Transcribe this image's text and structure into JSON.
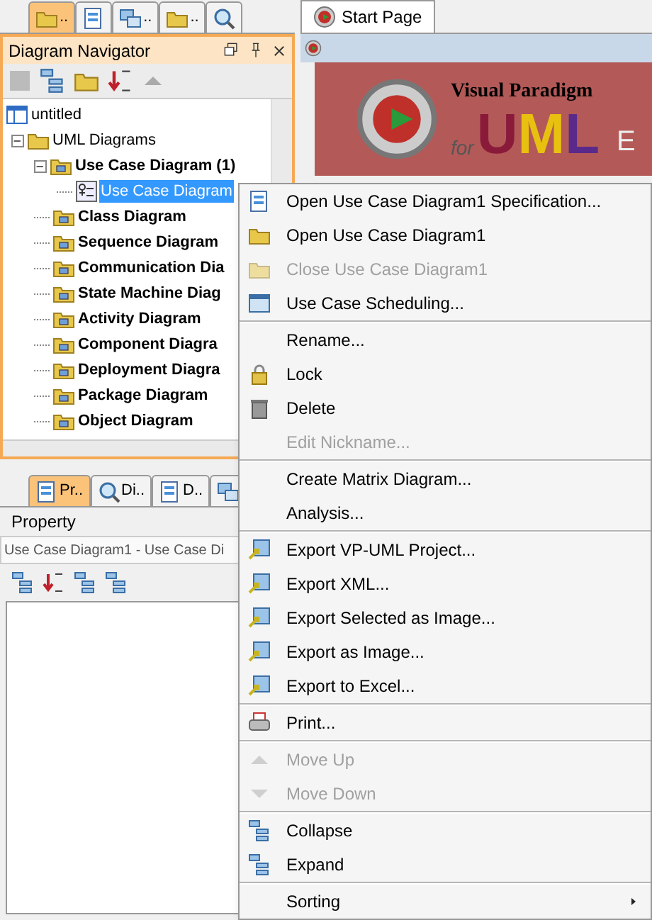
{
  "top_tabs": [
    {
      "label": "..",
      "selected": true
    },
    {
      "selected": false
    },
    {
      "label": "..",
      "selected": false
    },
    {
      "label": "..",
      "selected": false
    },
    {
      "selected": false
    }
  ],
  "navigator": {
    "title": "Diagram Navigator",
    "tree": [
      {
        "label": "untitled",
        "kind": "project",
        "selected": false,
        "children": [
          {
            "label": "UML Diagrams",
            "kind": "folder",
            "expanded": true,
            "selected": false,
            "children": [
              {
                "label": "Use Case Diagram (1)",
                "kind": "type",
                "expanded": true,
                "selected": false,
                "children": [
                  {
                    "label": "Use Case Diagram",
                    "kind": "diagram",
                    "selected": true
                  }
                ]
              },
              {
                "label": "Class Diagram",
                "kind": "type",
                "selected": false
              },
              {
                "label": "Sequence Diagram",
                "kind": "type",
                "selected": false
              },
              {
                "label": "Communication Dia",
                "kind": "type",
                "selected": false
              },
              {
                "label": "State Machine Diag",
                "kind": "type",
                "selected": false
              },
              {
                "label": "Activity Diagram",
                "kind": "type",
                "selected": false
              },
              {
                "label": "Component Diagra",
                "kind": "type",
                "selected": false
              },
              {
                "label": "Deployment Diagra",
                "kind": "type",
                "selected": false
              },
              {
                "label": "Package Diagram",
                "kind": "type",
                "selected": false
              },
              {
                "label": "Object Diagram",
                "kind": "type",
                "selected": false
              }
            ]
          }
        ]
      }
    ]
  },
  "bottom_tabs": [
    {
      "label": "Pr..",
      "selected": true
    },
    {
      "label": "Di..",
      "selected": false
    },
    {
      "label": "D..",
      "selected": false
    },
    {
      "selected": false
    }
  ],
  "property": {
    "title": "Property",
    "field": "Use Case Diagram1 - Use Case Di"
  },
  "editor_tab": {
    "label": "Start Page",
    "selected": true
  },
  "banner": {
    "brand": "Visual Paradigm",
    "for": "for",
    "product": "UML",
    "edition": "E"
  },
  "context_menu": [
    {
      "kind": "item",
      "label": "Open Use Case Diagram1 Specification...",
      "disabled": false
    },
    {
      "kind": "item",
      "label": "Open Use Case Diagram1",
      "disabled": false
    },
    {
      "kind": "item",
      "label": "Close Use Case Diagram1",
      "disabled": true
    },
    {
      "kind": "item",
      "label": "Use Case Scheduling...",
      "disabled": false
    },
    {
      "kind": "separator"
    },
    {
      "kind": "item",
      "label": "Rename...",
      "disabled": false
    },
    {
      "kind": "item",
      "label": "Lock",
      "disabled": false
    },
    {
      "kind": "item",
      "label": "Delete",
      "disabled": false
    },
    {
      "kind": "item",
      "label": "Edit Nickname...",
      "disabled": true
    },
    {
      "kind": "separator"
    },
    {
      "kind": "item",
      "label": "Create Matrix Diagram...",
      "disabled": false
    },
    {
      "kind": "item",
      "label": "Analysis...",
      "disabled": false
    },
    {
      "kind": "separator"
    },
    {
      "kind": "item",
      "label": "Export VP-UML Project...",
      "disabled": false
    },
    {
      "kind": "item",
      "label": "Export XML...",
      "disabled": false
    },
    {
      "kind": "item",
      "label": "Export Selected as Image...",
      "disabled": false
    },
    {
      "kind": "item",
      "label": "Export as Image...",
      "disabled": false
    },
    {
      "kind": "item",
      "label": "Export to Excel...",
      "disabled": false
    },
    {
      "kind": "separator"
    },
    {
      "kind": "item",
      "label": "Print...",
      "disabled": false
    },
    {
      "kind": "separator"
    },
    {
      "kind": "item",
      "label": "Move Up",
      "disabled": true
    },
    {
      "kind": "item",
      "label": "Move Down",
      "disabled": true
    },
    {
      "kind": "separator"
    },
    {
      "kind": "item",
      "label": "Collapse",
      "disabled": false
    },
    {
      "kind": "item",
      "label": "Expand",
      "disabled": false
    },
    {
      "kind": "separator"
    },
    {
      "kind": "submenu",
      "label": "Sorting",
      "disabled": false
    }
  ]
}
